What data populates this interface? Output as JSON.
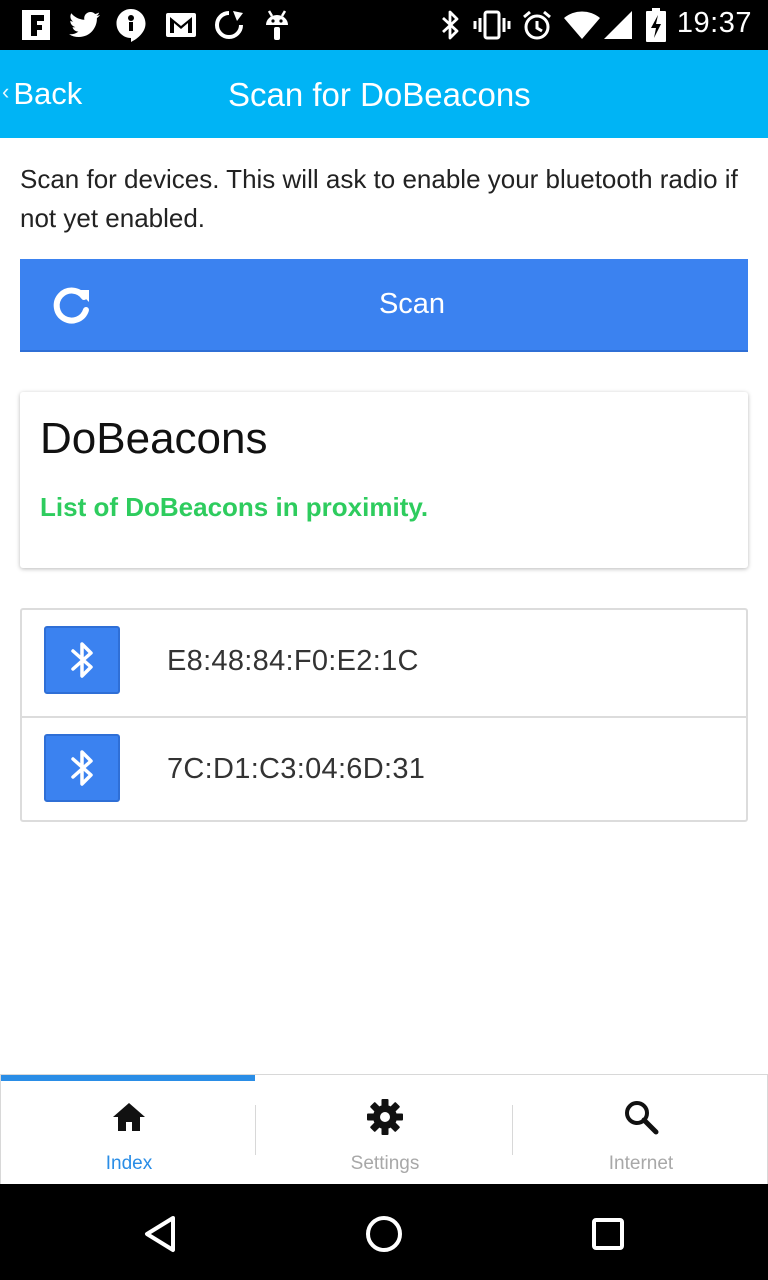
{
  "status_bar": {
    "time": "19:37",
    "left_icons": [
      "flipboard-icon",
      "twitter-icon",
      "hangouts-icon",
      "gmail-icon",
      "sync-icon",
      "android-icon"
    ],
    "right_icons": [
      "bluetooth-icon",
      "vibrate-icon",
      "alarm-icon",
      "wifi-icon",
      "signal-icon",
      "battery-charging-icon"
    ]
  },
  "nav": {
    "back_label": "Back",
    "title": "Scan for DoBeacons"
  },
  "intro_text": "Scan for devices. This will ask to enable your bluetooth radio if not yet enabled.",
  "scan_button": {
    "label": "Scan",
    "icon": "refresh-icon",
    "color": "#3b82f0"
  },
  "card": {
    "title": "DoBeacons",
    "subtitle": "List of DoBeacons in proximity.",
    "subtitle_color": "#2ecc5e"
  },
  "devices": [
    {
      "address": "E8:48:84:F0:E2:1C",
      "icon": "bluetooth-icon"
    },
    {
      "address": "7C:D1:C3:04:6D:31",
      "icon": "bluetooth-icon"
    }
  ],
  "tabs": [
    {
      "label": "Index",
      "icon": "home-icon",
      "active": true
    },
    {
      "label": "Settings",
      "icon": "gear-icon",
      "active": false
    },
    {
      "label": "Internet",
      "icon": "search-icon",
      "active": false
    }
  ],
  "colors": {
    "nav_bar": "#00b4f5",
    "accent": "#2a8de6",
    "device_icon_bg": "#3b82f0"
  },
  "system_nav": [
    "back-triangle-icon",
    "home-circle-icon",
    "recents-square-icon"
  ]
}
